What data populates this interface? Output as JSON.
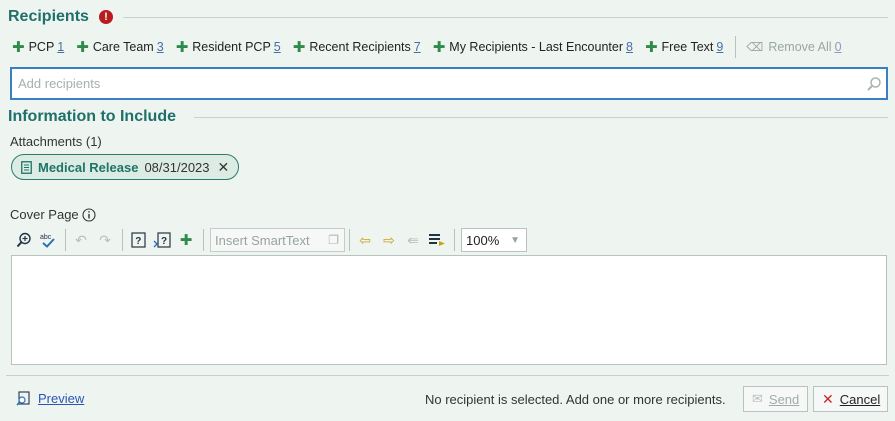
{
  "recipients": {
    "title": "Recipients",
    "alert_icon": "!",
    "buttons": [
      {
        "label": "PCP",
        "count": "1"
      },
      {
        "label": "Care Team",
        "count": "3"
      },
      {
        "label": "Resident PCP",
        "count": "5"
      },
      {
        "label": "Recent Recipients",
        "count": "7"
      },
      {
        "label": "My Recipients - Last Encounter",
        "count": "8"
      },
      {
        "label": "Free Text",
        "count": "9"
      }
    ],
    "remove_all": {
      "label": "Remove All",
      "count": "0"
    },
    "search_placeholder": "Add recipients"
  },
  "information": {
    "title": "Information to Include",
    "attachments_label": "Attachments (1)",
    "attachment": {
      "name": "Medical Release",
      "date": "08/31/2023"
    },
    "cover_page_label": "Cover Page",
    "smarttext_placeholder": "Insert SmartText",
    "zoom_value": "100%"
  },
  "footer": {
    "preview_label": "Preview",
    "status": "No recipient is selected. Add one or more recipients.",
    "send_label": "Send",
    "cancel_label": "Cancel"
  },
  "colors": {
    "accent": "#1f6f6a",
    "focus_border": "#3a7fc4",
    "alert": "#b81c1c",
    "add": "#2f8b4a"
  }
}
